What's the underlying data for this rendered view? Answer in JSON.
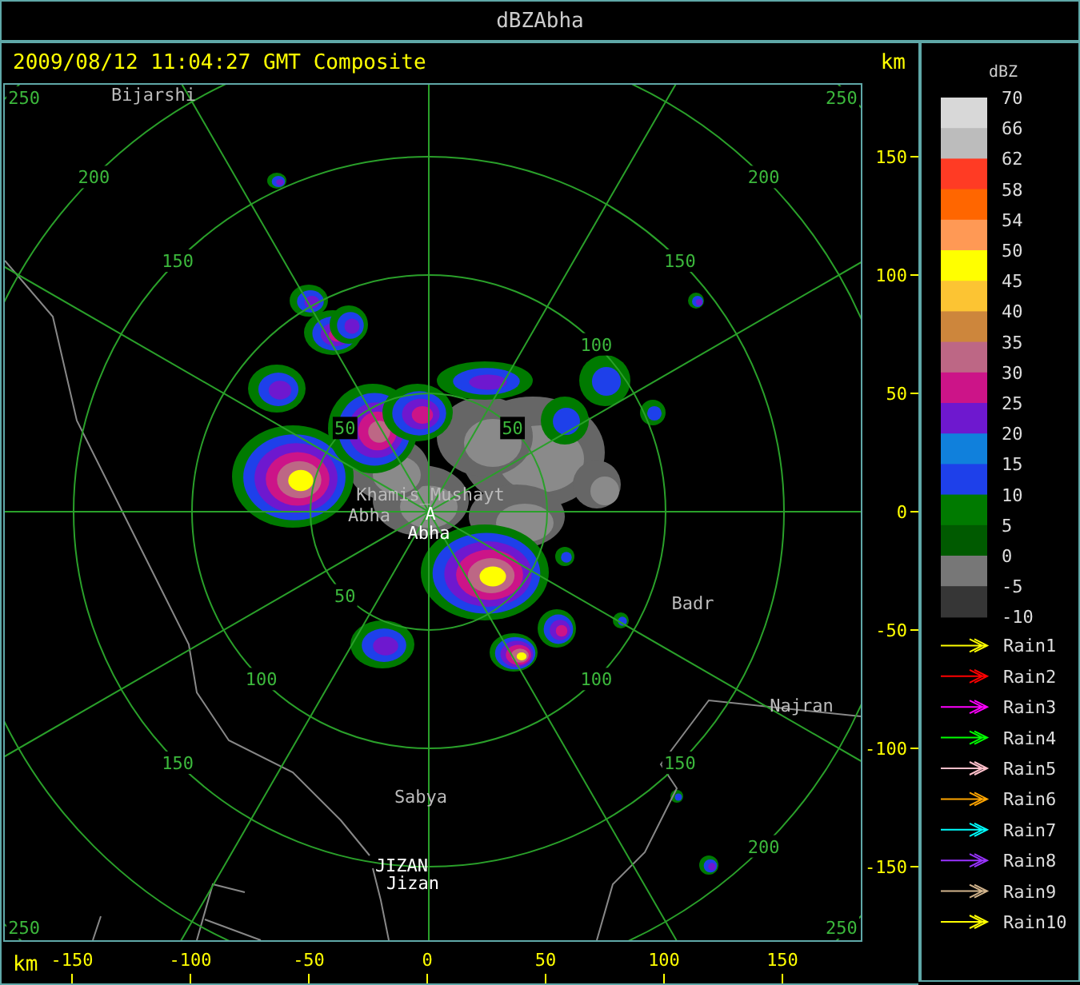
{
  "window": {
    "title": "dBZAbha"
  },
  "header": {
    "title": "2009/08/12 11:04:27 GMT Composite"
  },
  "map": {
    "rings": [
      {
        "labels": {
          "nw": "50",
          "ne": "50",
          "sw": "50"
        }
      },
      {
        "labels": {
          "ne": "100",
          "sw": "100",
          "se": "100"
        }
      },
      {
        "labels": {
          "nw": "150",
          "ne": "150",
          "sw": "150",
          "se": "150"
        }
      },
      {
        "labels": {
          "nw": "200",
          "ne": "200",
          "se": "200"
        }
      },
      {
        "labels": {
          "nw": "250",
          "ne": "250",
          "sw": "250",
          "se": "250"
        }
      }
    ],
    "places": [
      {
        "text": "Bijarshi",
        "kind": "city"
      },
      {
        "text": "Khamis_Mushayt",
        "kind": "city"
      },
      {
        "text": "Abha",
        "kind": "city"
      },
      {
        "text": "A",
        "kind": "radar"
      },
      {
        "text": "Abha",
        "kind": "radar"
      },
      {
        "text": "Badr",
        "kind": "city"
      },
      {
        "text": "Najran",
        "kind": "city"
      },
      {
        "text": "Sabya",
        "kind": "city"
      },
      {
        "text": "JIZAN",
        "kind": "radar"
      },
      {
        "text": "Jizan",
        "kind": "radar"
      }
    ]
  },
  "y_axis": {
    "unit": "km",
    "ticks": [
      "150",
      "100",
      "50",
      "0",
      "-50",
      "-100",
      "-150"
    ]
  },
  "x_axis": {
    "unit": "km",
    "ticks": [
      "-150",
      "-100",
      "-50",
      "0",
      "50",
      "100",
      "150"
    ]
  },
  "legend": {
    "title": "dBZ",
    "bins": [
      {
        "color": "#d8d8d8"
      },
      {
        "color": "#bcbcbc"
      },
      {
        "color": "#ff3b24"
      },
      {
        "color": "#ff6600"
      },
      {
        "color": "#ff9955"
      },
      {
        "color": "#ffff00"
      },
      {
        "color": "#fcc433"
      },
      {
        "color": "#cd863c"
      },
      {
        "color": "#bd6785"
      },
      {
        "color": "#cc1488"
      },
      {
        "color": "#6e18cf"
      },
      {
        "color": "#1080dc"
      },
      {
        "color": "#1e40ea"
      },
      {
        "color": "#007a00"
      },
      {
        "color": "#005a00"
      },
      {
        "color": "#777777"
      },
      {
        "color": "#363636"
      }
    ],
    "ticks": [
      "70",
      "66",
      "62",
      "58",
      "54",
      "50",
      "45",
      "40",
      "35",
      "30",
      "25",
      "20",
      "15",
      "10",
      "5",
      "0",
      "-5",
      "-10"
    ],
    "tracks": [
      {
        "label": "Rain1",
        "color": "#ffff00"
      },
      {
        "label": "Rain2",
        "color": "#ff0000"
      },
      {
        "label": "Rain3",
        "color": "#ff00ff"
      },
      {
        "label": "Rain4",
        "color": "#00ff00"
      },
      {
        "label": "Rain5",
        "color": "#ffc0cb"
      },
      {
        "label": "Rain6",
        "color": "#ffa500"
      },
      {
        "label": "Rain7",
        "color": "#00ffff"
      },
      {
        "label": "Rain8",
        "color": "#9933ff"
      },
      {
        "label": "Rain9",
        "color": "#d2b48c"
      },
      {
        "label": "Rain10",
        "color": "#ffff00"
      }
    ]
  }
}
